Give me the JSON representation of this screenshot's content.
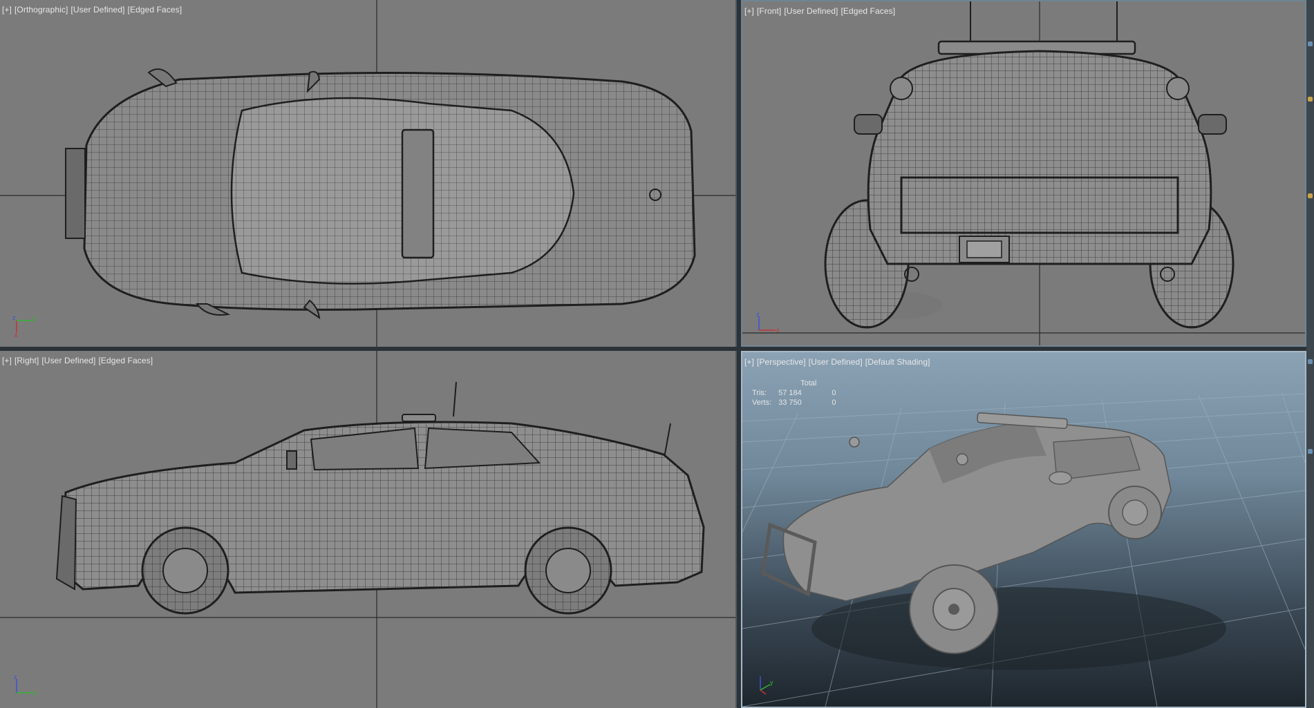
{
  "viewports": {
    "top": {
      "labels": [
        "[+]",
        "[Orthographic]",
        "[User Defined]",
        "[Edged Faces]"
      ]
    },
    "front": {
      "labels": [
        "[+]",
        "[Front]",
        "[User Defined]",
        "[Edged Faces]"
      ]
    },
    "right": {
      "labels": [
        "[+]",
        "[Right]",
        "[User Defined]",
        "[Edged Faces]"
      ]
    },
    "persp": {
      "labels": [
        "[+]",
        "[Perspective]",
        "[User Defined]",
        "[Default Shading]"
      ]
    }
  },
  "stats": {
    "header": "Total",
    "tris_label": "Tris:",
    "tris_value": "57 184",
    "tris_sel": "0",
    "verts_label": "Verts:",
    "verts_value": "33 750",
    "verts_sel": "0"
  },
  "gizmo": {
    "x": "x",
    "y": "y",
    "z": "z"
  },
  "colors": {
    "viewport_bg": "#7b7b7b",
    "active_border": "#a8b9c7",
    "gizmo_x": "#c83232",
    "gizmo_y": "#32b432",
    "gizmo_z": "#3c50dc"
  }
}
